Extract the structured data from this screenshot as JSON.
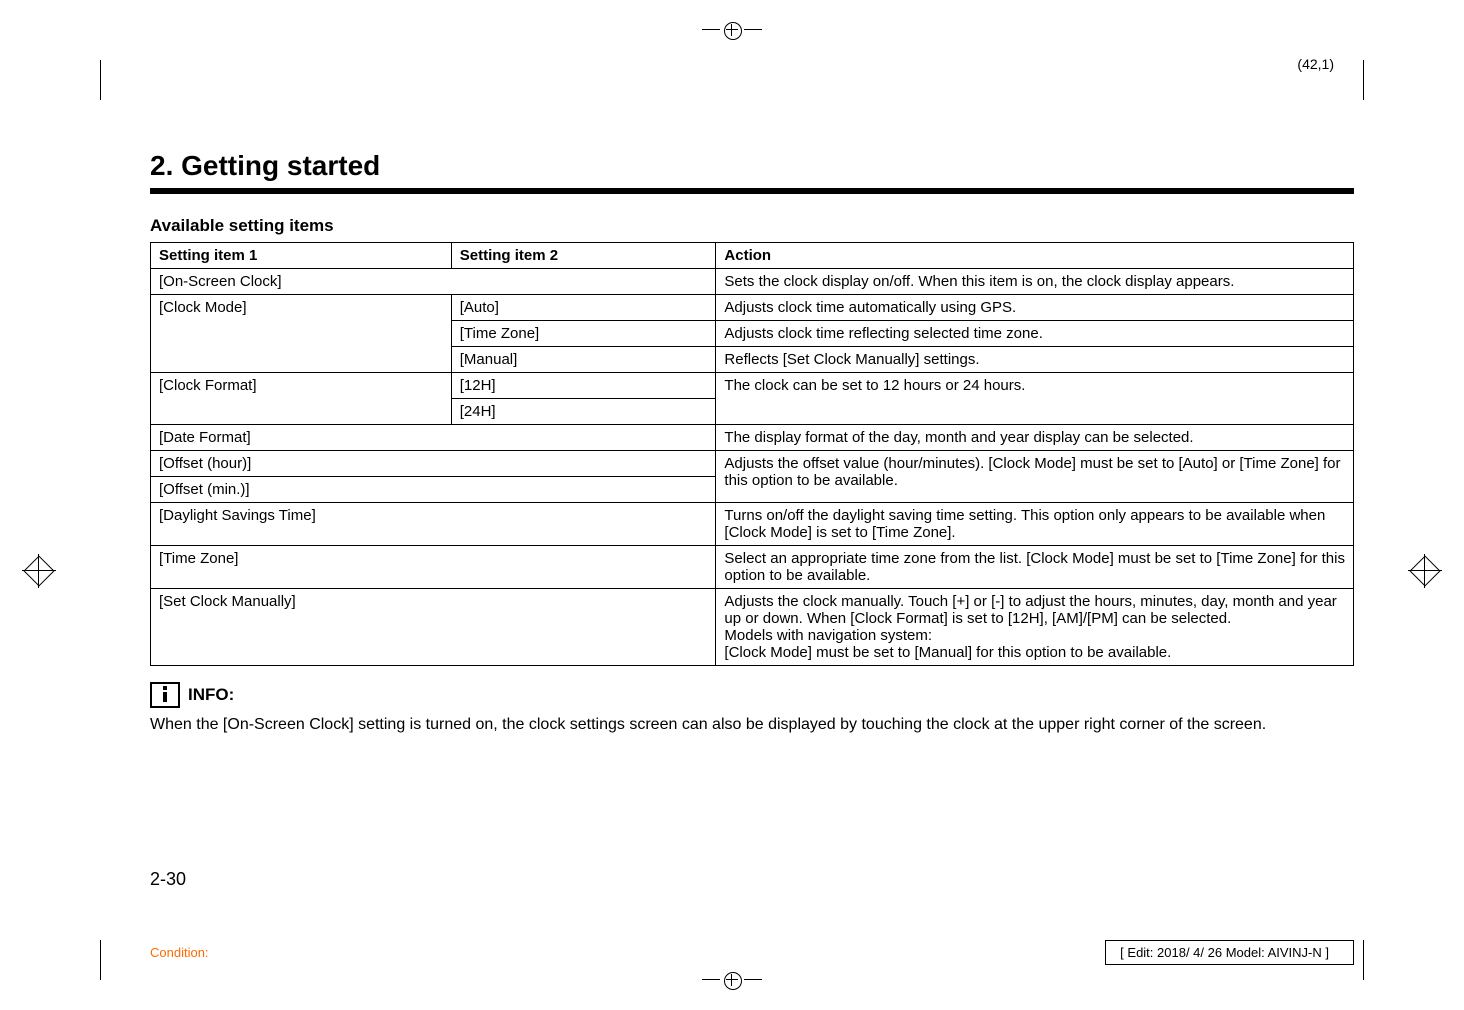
{
  "top_page_ref": "(42,1)",
  "section_title": "2. Getting started",
  "subheading": "Available setting items",
  "table": {
    "headers": [
      "Setting item 1",
      "Setting item 2",
      "Action"
    ],
    "rows": [
      {
        "c1": "[On-Screen Clock]",
        "c2": null,
        "c3": "Sets the clock display on/off. When this item is on, the clock display appears.",
        "span12": true
      },
      {
        "c1": "[Clock Mode]",
        "c2": "[Auto]",
        "c3": "Adjusts clock time automatically using GPS.",
        "c1_rowspan": 3
      },
      {
        "c2": "[Time Zone]",
        "c3": "Adjusts clock time reflecting selected time zone."
      },
      {
        "c2": "[Manual]",
        "c3": "Reflects [Set Clock Manually] settings."
      },
      {
        "c1": "[Clock Format]",
        "c2": "[12H]",
        "c3": "The clock can be set to 12 hours or 24 hours.",
        "c1_rowspan": 2,
        "c3_rowspan": 2
      },
      {
        "c2": "[24H]"
      },
      {
        "c1": "[Date Format]",
        "c2": null,
        "c3": "The display format of the day, month and year display can be selected.",
        "span12": true
      },
      {
        "c1": "[Offset (hour)]",
        "c2": null,
        "c3": "Adjusts the offset value (hour/minutes). [Clock Mode] must be set to [Auto] or [Time Zone] for this option to be available.",
        "span12": true,
        "c3_rowspan": 2
      },
      {
        "c1": "[Offset (min.)]",
        "c2": null,
        "span12": true
      },
      {
        "c1": "[Daylight Savings Time]",
        "c2": null,
        "c3": "Turns on/off the daylight saving time setting. This option only appears to be available when [Clock Mode] is set to [Time Zone].",
        "span12": true
      },
      {
        "c1": "[Time Zone]",
        "c2": null,
        "c3": "Select an appropriate time zone from the list. [Clock Mode] must be set to [Time Zone] for this option to be available.",
        "span12": true
      },
      {
        "c1": "[Set Clock Manually]",
        "c2": null,
        "c3": "Adjusts the clock manually. Touch [+] or [-] to adjust the hours, minutes, day, month and year up or down. When [Clock Format] is set to [12H], [AM]/[PM] can be selected.\nModels with navigation system:\n[Clock Mode] must be set to [Manual] for this option to be available.",
        "span12": true
      }
    ]
  },
  "info_label": "INFO:",
  "info_text": "When the [On-Screen Clock] setting is turned on, the clock settings screen can also be displayed by touching the clock at the upper right corner of the screen.",
  "page_number": "2-30",
  "condition_label": "Condition:",
  "edit_box": "[ Edit: 2018/ 4/ 26   Model: AIVINJ-N ]"
}
